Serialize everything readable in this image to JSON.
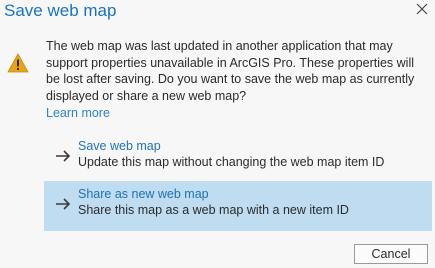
{
  "dialog": {
    "title": "Save web map",
    "close_icon": "close-icon",
    "warning_icon": "warning-triangle-icon",
    "warning_color": "#e8a317",
    "accent": "#1a73b8",
    "message": "The web map was last updated in another application that may support properties unavailable in ArcGIS Pro. These properties will be lost after saving. Do you want to save the web map as currently displayed or share a new web map?",
    "learn_more": "Learn more",
    "options": [
      {
        "title": "Save web map",
        "description": "Update this map without changing the web map item ID",
        "icon": "arrow-right-icon",
        "selected": false
      },
      {
        "title": "Share as new web map",
        "description": "Share this map as a web map with a new item ID",
        "icon": "arrow-right-icon",
        "selected": true,
        "highlight": "#bfdcf0"
      }
    ],
    "cancel_label": "Cancel"
  }
}
